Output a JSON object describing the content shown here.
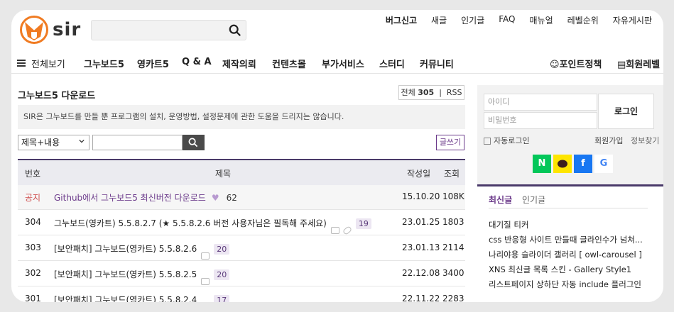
{
  "top_links": [
    "버그신고",
    "새글",
    "인기글",
    "FAQ",
    "매뉴얼",
    "레벨순위",
    "자유게시판"
  ],
  "logo_text": "sir",
  "nav": {
    "all": "전체보기",
    "items": [
      "그누보드5",
      "영카트5",
      "Q & A",
      "제작의뢰",
      "컨텐츠몰",
      "부가서비스",
      "스터디",
      "커뮤니티"
    ],
    "point_policy": "포인트정책",
    "member_level": "회원레벨"
  },
  "board": {
    "title": "그누보드5 다운로드",
    "total_label": "전체",
    "total": "305",
    "rss": "RSS",
    "notice": "SIR은 그누보드를 만들 뿐 프로그램의 설치, 운영방법, 설정문제에 관한 도움을 드리지는 않습니다.",
    "filter_selected": "제목+내용",
    "write_label": "글쓰기",
    "columns": {
      "num": "번호",
      "title": "제목",
      "date": "작성일",
      "views": "조회"
    },
    "rows": [
      {
        "num": "공지",
        "title": "Github에서 그누보드5 최신버전 다운로드",
        "likes": "62",
        "date": "15.10.20",
        "views": "108K"
      },
      {
        "num": "304",
        "title": "그누보드(영카트) 5.5.8.2.7 (★ 5.5.8.2.6 버전 사용자님은 필독해 주세요)",
        "comments": "19",
        "date": "23.01.25",
        "views": "1803"
      },
      {
        "num": "303",
        "title": "[보안패치] 그누보드(영카트) 5.5.8.2.6",
        "comments": "20",
        "date": "23.01.13",
        "views": "2114"
      },
      {
        "num": "302",
        "title": "[보안패치] 그누보드(영카트) 5.5.8.2.5",
        "comments": "20",
        "date": "22.12.08",
        "views": "3400"
      },
      {
        "num": "301",
        "title": "[보안패치] 그누보드(영카트) 5.5.8.2.4",
        "comments": "17",
        "date": "22.11.22",
        "views": "2283"
      }
    ]
  },
  "login": {
    "id_placeholder": "아이디",
    "pw_placeholder": "비밀번호",
    "login_button": "로그인",
    "auto_login": "자동로그인",
    "join": "회원가입",
    "find": "정보찾기"
  },
  "social": [
    "N",
    "K",
    "f",
    "G"
  ],
  "latest": {
    "tab_latest": "최신글",
    "tab_popular": "인기글",
    "items": [
      "대기질 티커",
      "css 반응형 사이트 만들때 글라인수가 넘쳐...",
      "나리야용 슬라이더 갤러리 [ owl-carousel ]",
      "XNS 최신글 목록 스킨 - Gallery Style1",
      "리스트페이지 상하단 자동 include 플러그인"
    ]
  }
}
